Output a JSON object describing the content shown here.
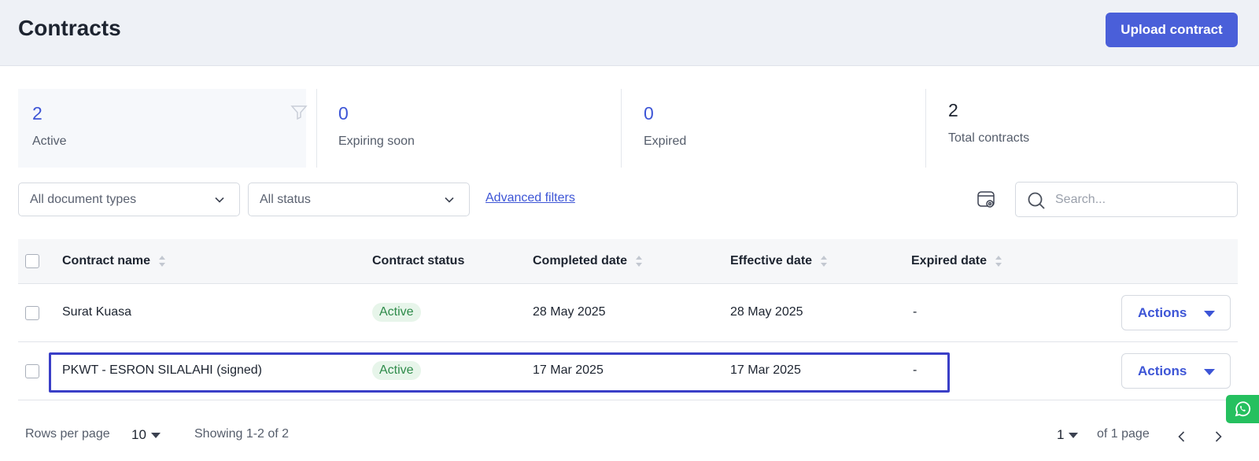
{
  "header": {
    "title": "Contracts",
    "upload_label": "Upload contract"
  },
  "stats": [
    {
      "value": "2",
      "label": "Active"
    },
    {
      "value": "0",
      "label": "Expiring soon"
    },
    {
      "value": "0",
      "label": "Expired"
    },
    {
      "value": "2",
      "label": "Total contracts"
    }
  ],
  "filters": {
    "document_type": "All document types",
    "status": "All status",
    "advanced_label": "Advanced filters"
  },
  "search": {
    "placeholder": "Search..."
  },
  "table": {
    "columns": [
      "Contract name",
      "Contract status",
      "Completed date",
      "Effective date",
      "Expired date"
    ],
    "rows": [
      {
        "name": "Surat Kuasa",
        "status": "Active",
        "completed": "28 May 2025",
        "effective": "28 May 2025",
        "expired": "-",
        "actions": "Actions"
      },
      {
        "name": "PKWT - ESRON SILALAHI (signed)",
        "status": "Active",
        "completed": "17 Mar 2025",
        "effective": "17 Mar 2025",
        "expired": "-",
        "actions": "Actions"
      }
    ]
  },
  "pagination": {
    "rows_per_page_label": "Rows per page",
    "rows_per_page": "10",
    "showing": "Showing 1-2 of 2",
    "current_page": "1",
    "of_pages": "of 1 page"
  },
  "colors": {
    "accent": "#4a5fd9",
    "active_badge_bg": "#e7f5ea",
    "active_badge_text": "#2e8b4a",
    "whatsapp": "#25c05f"
  },
  "icons": [
    "filter-icon",
    "chevron-down-icon",
    "settings-icon",
    "search-icon",
    "sort-icon",
    "caret-down-icon",
    "chevron-left-icon",
    "chevron-right-icon",
    "whatsapp-icon"
  ]
}
